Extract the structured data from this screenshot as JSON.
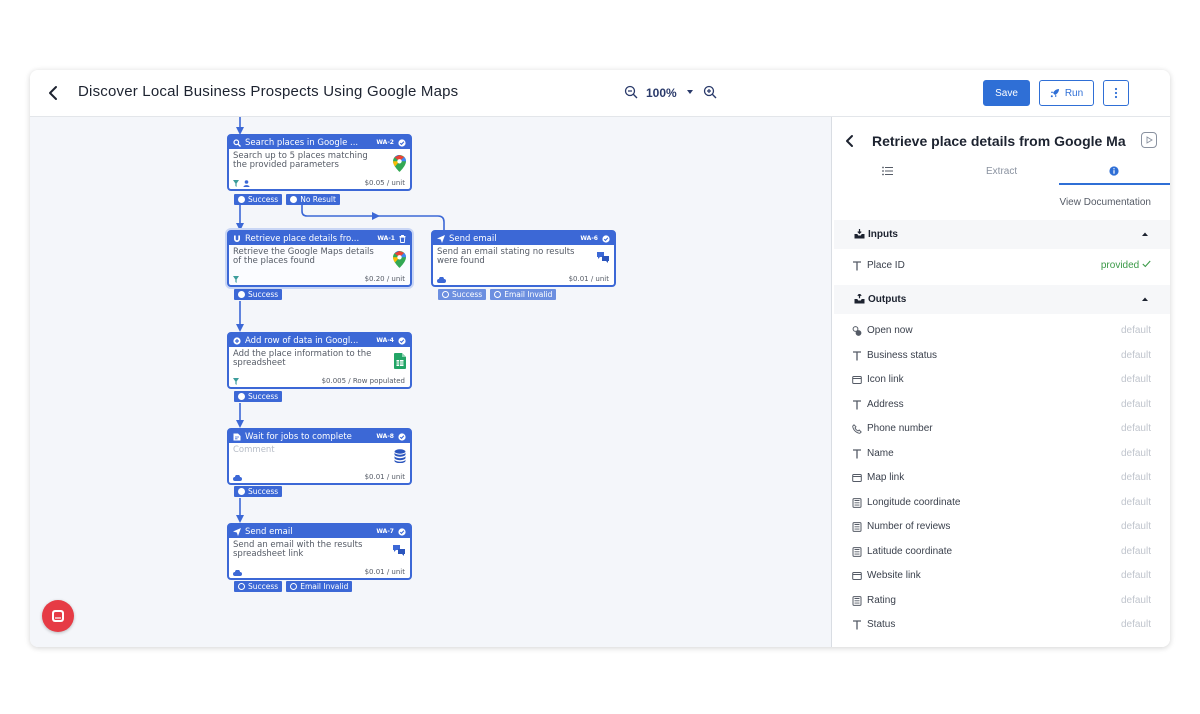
{
  "header": {
    "title": "Discover Local Business Prospects Using Google Maps",
    "zoom": "100%",
    "save_label": "Save",
    "run_label": "Run"
  },
  "nodes": [
    {
      "title": "Search places in Google ...",
      "id": "WA-2",
      "description": "Search up to 5 places matching the provided parameters",
      "price": "$0.05 / unit",
      "icon": "google-maps-icon",
      "outputs": [
        "Success",
        "No Result"
      ]
    },
    {
      "title": "Retrieve place details fro...",
      "id": "WA-1",
      "description": "Retrieve the Google Maps details of the places found",
      "price": "$0.20 / unit",
      "icon": "google-maps-icon",
      "outputs": [
        "Success"
      ]
    },
    {
      "title": "Send email",
      "id": "WA-6",
      "description": "Send an email stating no results were found",
      "price": "$0.01 / unit",
      "icon": "chat-bubbles-icon",
      "outputs": [
        "Success",
        "Email Invalid"
      ]
    },
    {
      "title": "Add row of data in Googl...",
      "id": "WA-4",
      "description": "Add the place information to the spreadsheet",
      "price": "$0.005 / Row populated",
      "icon": "google-sheets-icon",
      "outputs": [
        "Success"
      ]
    },
    {
      "title": "Wait for jobs to complete",
      "id": "WA-8",
      "description": "Comment",
      "price": "$0.01 / unit",
      "icon": "database-icon",
      "outputs": [
        "Success"
      ]
    },
    {
      "title": "Send email",
      "id": "WA-7",
      "description": "Send an email with the results spreadsheet link",
      "price": "$0.01 / unit",
      "icon": "chat-bubbles-icon",
      "outputs": [
        "Success",
        "Email Invalid"
      ]
    }
  ],
  "panel": {
    "title": "Retrieve place details from Google Ma",
    "tabs": [
      "Extract"
    ],
    "view_doc": "View Documentation",
    "inputs_label": "Inputs",
    "outputs_label": "Outputs",
    "inputs": [
      {
        "label": "Place ID",
        "status": "provided",
        "icon": "text-icon"
      }
    ],
    "outputs": [
      {
        "label": "Open now",
        "status": "default",
        "icon": "toggle-icon"
      },
      {
        "label": "Business status",
        "status": "default",
        "icon": "text-icon"
      },
      {
        "label": "Icon link",
        "status": "default",
        "icon": "link-box-icon"
      },
      {
        "label": "Address",
        "status": "default",
        "icon": "text-icon"
      },
      {
        "label": "Phone number",
        "status": "default",
        "icon": "phone-icon"
      },
      {
        "label": "Name",
        "status": "default",
        "icon": "text-icon"
      },
      {
        "label": "Map link",
        "status": "default",
        "icon": "link-box-icon"
      },
      {
        "label": "Longitude coordinate",
        "status": "default",
        "icon": "number-icon"
      },
      {
        "label": "Number of reviews",
        "status": "default",
        "icon": "number-icon"
      },
      {
        "label": "Latitude coordinate",
        "status": "default",
        "icon": "number-icon"
      },
      {
        "label": "Website link",
        "status": "default",
        "icon": "link-box-icon"
      },
      {
        "label": "Rating",
        "status": "default",
        "icon": "number-icon"
      },
      {
        "label": "Status",
        "status": "default",
        "icon": "text-icon"
      }
    ]
  },
  "colors": {
    "accent": "#2f6fd6",
    "node": "#3c68d6",
    "provided": "#3b9a48",
    "fab": "#e63b45"
  }
}
